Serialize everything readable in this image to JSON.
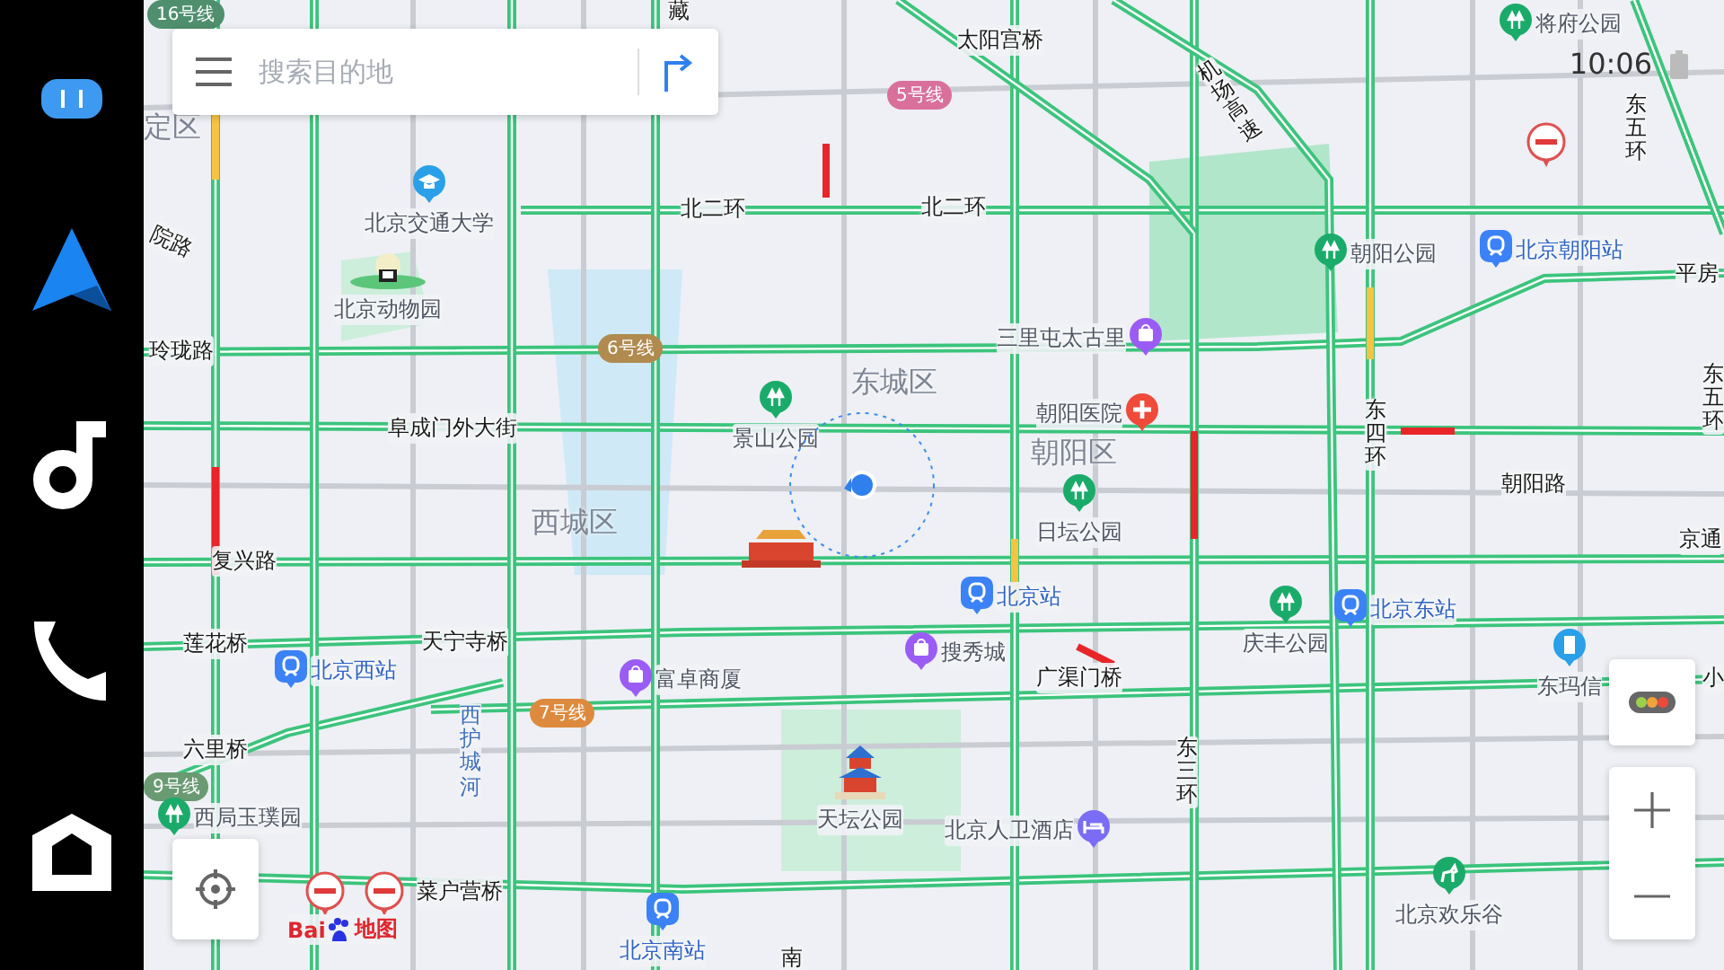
{
  "dock": [
    {
      "kind": "assistant"
    },
    {
      "kind": "navigation"
    },
    {
      "kind": "music"
    },
    {
      "kind": "phone"
    },
    {
      "kind": "home"
    }
  ],
  "search": {
    "placeholder": "搜索目的地"
  },
  "status": {
    "time": "10:06"
  },
  "map": {
    "labels": [
      {
        "text": "16号线",
        "kind": "line",
        "color": "#4f8f6e"
      },
      {
        "text": "藏",
        "kind": "road"
      },
      {
        "text": "太阳宫桥",
        "kind": "road"
      },
      {
        "text": "将府公园",
        "kind": "park"
      },
      {
        "text": "5号线",
        "kind": "line",
        "color": "#d9709c"
      },
      {
        "text": "定区",
        "kind": "district"
      },
      {
        "text": "机场高速",
        "kind": "vroad"
      },
      {
        "text": "东五环",
        "kind": "vroad"
      },
      {
        "text": "北京交通大学",
        "kind": "school"
      },
      {
        "text": "北二环",
        "kind": "road"
      },
      {
        "text": "北二环",
        "kind": "road"
      },
      {
        "text": "院路",
        "kind": "road"
      },
      {
        "text": "朝阳公园",
        "kind": "park"
      },
      {
        "text": "北京朝阳站",
        "kind": "train"
      },
      {
        "text": "平房",
        "kind": "road"
      },
      {
        "text": "北京动物园",
        "kind": "zoo"
      },
      {
        "text": "三里屯太古里",
        "kind": "shop"
      },
      {
        "text": "玲珑路",
        "kind": "road"
      },
      {
        "text": "6号线",
        "kind": "line",
        "color": "#b08a4e"
      },
      {
        "text": "东城区",
        "kind": "district"
      },
      {
        "text": "东五环",
        "kind": "vroad"
      },
      {
        "text": "景山公园",
        "kind": "park"
      },
      {
        "text": "朝阳医院",
        "kind": "hospital"
      },
      {
        "text": "阜成门外大街",
        "kind": "road"
      },
      {
        "text": "朝阳区",
        "kind": "district"
      },
      {
        "text": "东四环",
        "kind": "vroad"
      },
      {
        "text": "朝阳路",
        "kind": "road"
      },
      {
        "text": "西城区",
        "kind": "district"
      },
      {
        "text": "日坛公园",
        "kind": "park"
      },
      {
        "text": "京通",
        "kind": "road"
      },
      {
        "text": "复兴路",
        "kind": "road"
      },
      {
        "text": "北京站",
        "kind": "train"
      },
      {
        "text": "庆丰公园",
        "kind": "park"
      },
      {
        "text": "北京东站",
        "kind": "train"
      },
      {
        "text": "莲花桥",
        "kind": "road"
      },
      {
        "text": "天宁寺桥",
        "kind": "road"
      },
      {
        "text": "北京西站",
        "kind": "train"
      },
      {
        "text": "富卓商厦",
        "kind": "shop"
      },
      {
        "text": "搜秀城",
        "kind": "shop"
      },
      {
        "text": "广渠门桥",
        "kind": "road"
      },
      {
        "text": "东玛信",
        "kind": "building"
      },
      {
        "text": "小",
        "kind": "road"
      },
      {
        "text": "六里桥",
        "kind": "road"
      },
      {
        "text": "9号线",
        "kind": "line",
        "color": "#6a9a72"
      },
      {
        "text": "西护城河",
        "kind": "river"
      },
      {
        "text": "7号线",
        "kind": "line",
        "color": "#de8a3e"
      },
      {
        "text": "东三环",
        "kind": "vroad"
      },
      {
        "text": "天坛公园",
        "kind": "temple"
      },
      {
        "text": "北京人卫酒店",
        "kind": "hotel"
      },
      {
        "text": "西局玉璞园",
        "kind": "park"
      },
      {
        "text": "菜户营桥",
        "kind": "road"
      },
      {
        "text": "北京欢乐谷",
        "kind": "amusement"
      },
      {
        "text": "北京南站",
        "kind": "train"
      },
      {
        "text": "南",
        "kind": "road"
      }
    ]
  },
  "logo": {
    "left": "Bai",
    "right": "地图"
  }
}
